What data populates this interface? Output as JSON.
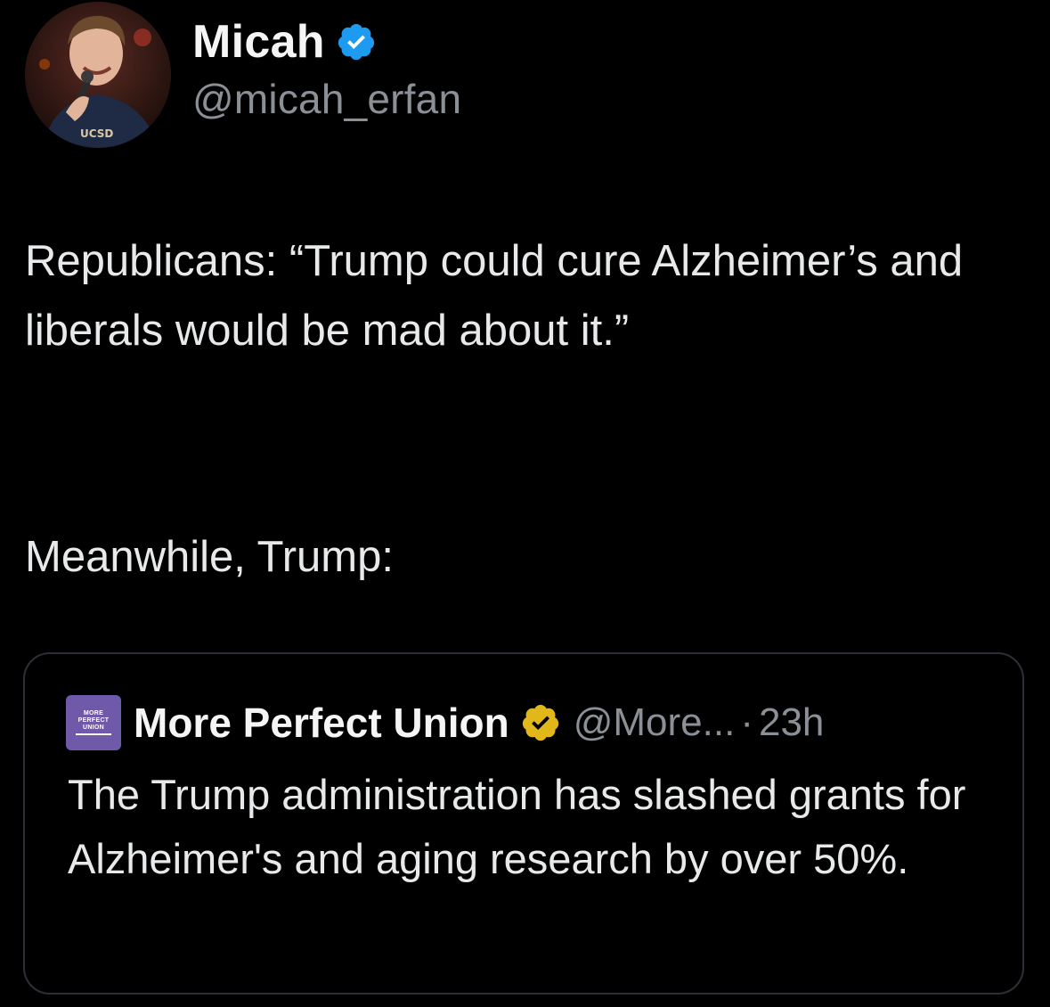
{
  "tweet": {
    "author": {
      "name": "Micah",
      "handle": "@micah_erfan",
      "verified_color": "#1d9bf0"
    },
    "text_paragraphs": [
      "Republicans: “Trump could cure Alzheimer’s and liberals would be mad about it.”",
      "Meanwhile, Trump:"
    ],
    "quote": {
      "author": {
        "name": "More Perfect Union",
        "handle": "@More...",
        "separator": "·",
        "time": "23h",
        "avatar_text": [
          "MORE",
          "PERFECT",
          "UNION"
        ],
        "avatar_color": "#6e5aa8",
        "badge_color": "#e2b719"
      },
      "text": "The Trump administration has slashed grants for Alzheimer's and aging research by over 50%."
    }
  },
  "colors": {
    "background": "#000000",
    "text": "#e7e9ea",
    "secondary_text": "#8b9096",
    "card_border": "#2c3036"
  }
}
